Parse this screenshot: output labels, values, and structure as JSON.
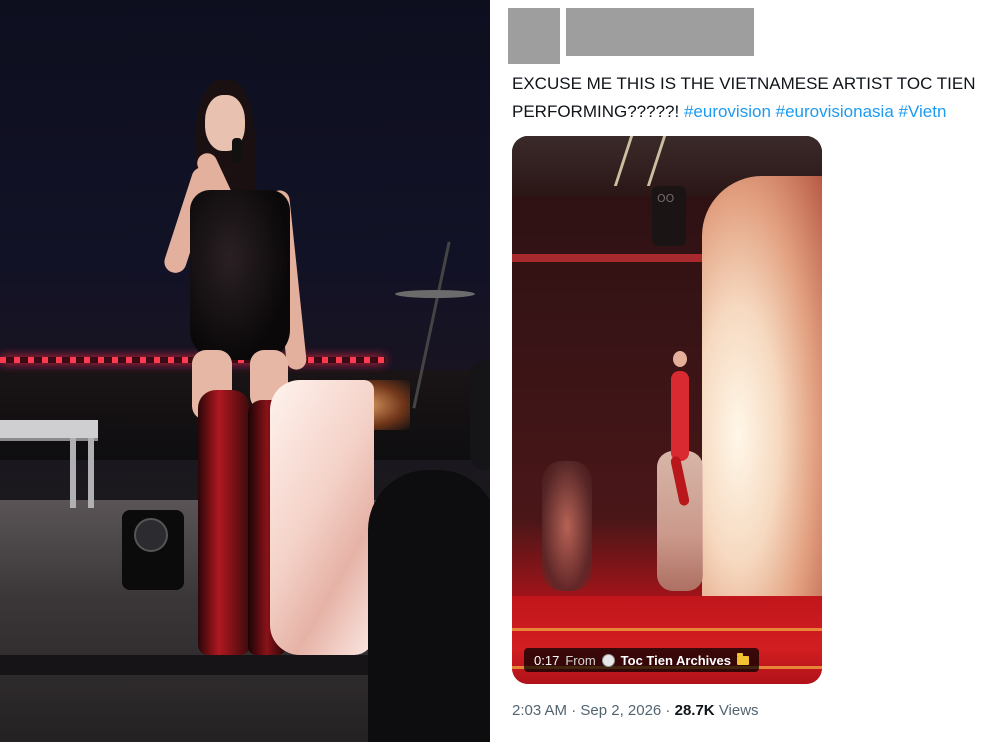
{
  "tweet": {
    "text_line1": "EXCUSE ME THIS IS THE VIETNAMESE ARTIST TOC TIEN",
    "text_line2_plain": "PERFORMING?????! ",
    "hashtags": [
      "#eurovision",
      "#eurovisionasia",
      "#Vietn"
    ],
    "media": {
      "duration": "0:17",
      "from_label": "From",
      "source_name": "Toc Tien Archives",
      "source_icon": "globe-icon",
      "folder_icon": "folder-icon"
    },
    "timestamp": "2:03 AM · Sep 2, 2026 · ",
    "views_count": "28.7K",
    "views_label": "Views"
  },
  "colors": {
    "hashtag": "#1d9bf0",
    "text": "#0f1419",
    "meta": "#536471",
    "redaction": "#9e9e9e"
  }
}
